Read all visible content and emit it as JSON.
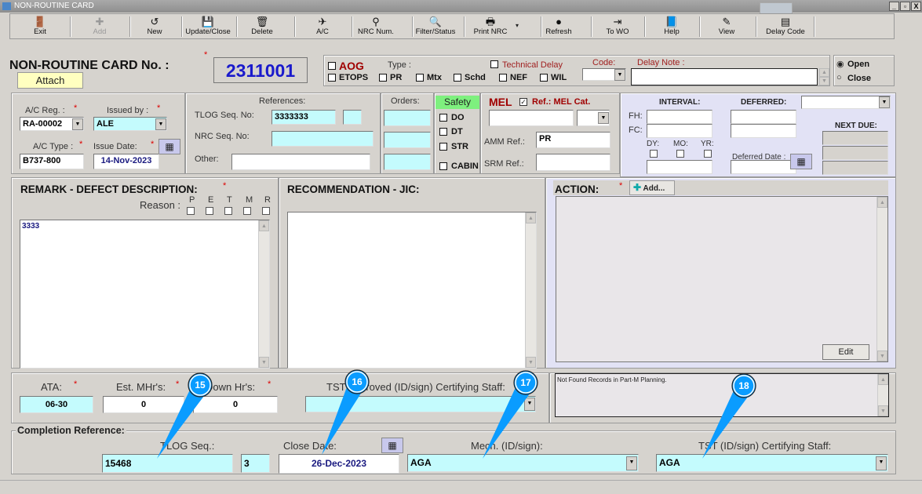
{
  "window": {
    "title": "NON-ROUTINE CARD",
    "minimize": "_",
    "maximize": "▫",
    "close": "X"
  },
  "toolbar": [
    {
      "label": "Exit",
      "icon": "exit-door-icon",
      "glyph": "🚪",
      "enabled": true
    },
    {
      "label": "Add",
      "icon": "plus-icon",
      "glyph": "✚",
      "enabled": false
    },
    {
      "label": "New",
      "icon": "new-icon",
      "glyph": "↺",
      "enabled": true
    },
    {
      "label": "Update/Close",
      "icon": "floppy-disk-icon",
      "glyph": "💾",
      "enabled": true
    },
    {
      "label": "Delete",
      "icon": "trash-icon",
      "glyph": "🗑",
      "enabled": true
    },
    {
      "label": "A/C",
      "icon": "airplane-icon",
      "glyph": "✈",
      "enabled": true
    },
    {
      "label": "NRC Num.",
      "icon": "lookup-icon",
      "glyph": "⚲",
      "enabled": true
    },
    {
      "label": "Filter/Status",
      "icon": "magnifier-icon",
      "glyph": "🔍",
      "enabled": true
    },
    {
      "label": "Print NRC",
      "icon": "printer-icon",
      "glyph": "🖶",
      "enabled": true
    },
    {
      "label": "Refresh",
      "icon": "refresh-icon",
      "glyph": "●",
      "enabled": true
    },
    {
      "label": "To WO",
      "icon": "to-wo-icon",
      "glyph": "⇥",
      "enabled": true
    },
    {
      "label": "Help",
      "icon": "help-book-icon",
      "glyph": "📘",
      "enabled": true
    },
    {
      "label": "View",
      "icon": "view-icon",
      "glyph": "✎",
      "enabled": true
    },
    {
      "label": "Delay Code",
      "icon": "delay-code-icon",
      "glyph": "▤",
      "enabled": true
    }
  ],
  "header": {
    "title": "NON-ROUTINE CARD No. :",
    "attach": "Attach",
    "card_no": "2311001",
    "required": "*"
  },
  "type": {
    "aog": "AOG",
    "type_label": "Type :",
    "etops": "ETOPS",
    "pr": "PR",
    "mtx": "Mtx",
    "schd": "Schd",
    "nef": "NEF",
    "wil": "WIL",
    "technical_delay": "Technical Delay",
    "code_label": "Code:",
    "code_value": "",
    "delay_note_label": "Delay Note :",
    "delay_note": ""
  },
  "status": {
    "open": "Open",
    "close": "Close",
    "selected": "Open"
  },
  "aircraft": {
    "reg_label": "A/C Reg. :",
    "reg": "RA-00002",
    "issued_by_label": "Issued by :",
    "issued_by": "ALE",
    "type_label": "A/C Type :",
    "type": "B737-800",
    "issue_date_label": "Issue Date:",
    "issue_date": "14-Nov-2023"
  },
  "references": {
    "title": "References:",
    "tlog_label": "TLOG Seq. No:",
    "tlog": "3333333",
    "tlog2": "",
    "nrc_label": "NRC Seq. No:",
    "nrc": "",
    "other_label": "Other:",
    "other": ""
  },
  "orders": {
    "title": "Orders:"
  },
  "safety": {
    "title": "Safety",
    "do": "DO",
    "dt": "DT",
    "str": "STR",
    "cabin": "CABIN"
  },
  "mel": {
    "title": "MEL",
    "ref_cat": "Ref.: MEL Cat.",
    "ref_checked": true,
    "amm_label": "AMM Ref.:",
    "amm": "PR",
    "srm_label": "SRM Ref.:",
    "srm": ""
  },
  "interval": {
    "title": "INTERVAL:",
    "deferred": "DEFERRED:",
    "fh": "FH:",
    "fc": "FC:",
    "dy": "DY:",
    "mo": "MO:",
    "yr": "YR:",
    "deferred_date": "Deferred Date :",
    "next_due": "NEXT DUE:"
  },
  "remark": {
    "title": "REMARK - DEFECT DESCRIPTION:",
    "reason": "Reason :",
    "reasons": [
      "P",
      "E",
      "T",
      "M",
      "R"
    ],
    "text": "3333"
  },
  "recommendation": {
    "title": "RECOMMENDATION - JIC:",
    "text": ""
  },
  "action": {
    "title": "ACTION:",
    "add": "Add...",
    "edit": "Edit"
  },
  "hours": {
    "ata_label": "ATA:",
    "ata": "06-30",
    "mhrs_label": "Est. MHr's:",
    "mhrs": "0",
    "down_label": "Down Hr's:",
    "down": "0",
    "tst_label": "TST Approved (ID/sign) Certifying Staff:",
    "tst": ""
  },
  "message": "Not Found Records in Part-M Planning.",
  "completion": {
    "title": "Completion Reference:",
    "tlog_label": "TLOG Seq.:",
    "tlog": "15468",
    "tlog2": "3",
    "close_date_label": "Close Date:",
    "close_date": "26-Dec-2023",
    "mech_label": "Mech. (ID/sign):",
    "mech": "AGA",
    "tst_label": "TST (ID/sign) Certifying Staff:",
    "tst": "AGA"
  },
  "callouts": [
    "15",
    "16",
    "17",
    "18"
  ],
  "colors": {
    "accent_cyan": "#c4fbfd",
    "card_no": "#1a1acc",
    "date": "#1a1a80",
    "red_label": "#a00000",
    "panel": "#e2e2f5",
    "callout": "#0a9cff"
  }
}
